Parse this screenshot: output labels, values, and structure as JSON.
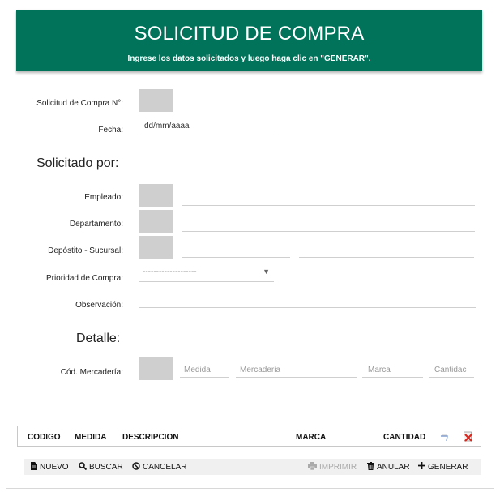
{
  "header": {
    "title": "SOLICITUD DE COMPRA",
    "subtitle": "Ingrese los datos solicitados y luego haga clic en \"GENERAR\"."
  },
  "form": {
    "solicitud_label": "Solicitud de Compra N°:",
    "fecha_label": "Fecha:",
    "fecha_value": "dd/mm/aaaa",
    "solicitado_por_heading": "Solicitado por:",
    "empleado_label": "Empleado:",
    "departamento_label": "Departamento:",
    "deposito_label": "Depóstito - Sucursal:",
    "prioridad_label": "Prioridad de Compra:",
    "prioridad_value": "--------------------",
    "observacion_label": "Observación:",
    "detalle_heading": "Detalle:",
    "cod_mercaderia_label": "Cód. Mercadería:",
    "medida_placeholder": "Medida",
    "mercaderia_placeholder": "Mercaderia",
    "marca_placeholder": "Marca",
    "cantidad_placeholder": "Cantidac"
  },
  "table": {
    "columns": [
      "CODIGO",
      "MEDIDA",
      "DESCRIPCION",
      "MARCA",
      "CANTIDAD"
    ]
  },
  "toolbar": {
    "nuevo": "NUEVO",
    "buscar": "BUSCAR",
    "cancelar": "CANCELAR",
    "imprimir": "IMPRIMIR",
    "anular": "ANULAR",
    "generar": "GENERAR"
  },
  "colors": {
    "header_bg": "#00735a",
    "field_gray": "#cfcfcf",
    "delete_red": "#d9261c"
  }
}
